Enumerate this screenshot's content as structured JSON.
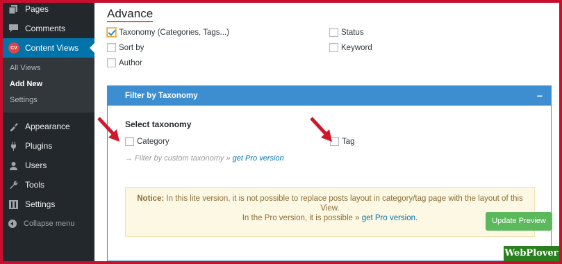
{
  "sidebar": {
    "items": [
      {
        "label": "Pages",
        "icon": "pages-icon"
      },
      {
        "label": "Comments",
        "icon": "comments-icon"
      },
      {
        "label": "Content Views",
        "icon": "content-views-icon",
        "badge": "CV"
      }
    ],
    "submenu": [
      "All Views",
      "Add New",
      "Settings"
    ],
    "items_after": [
      {
        "label": "Appearance",
        "icon": "appearance-icon"
      },
      {
        "label": "Plugins",
        "icon": "plugins-icon"
      },
      {
        "label": "Users",
        "icon": "users-icon"
      },
      {
        "label": "Tools",
        "icon": "tools-icon"
      },
      {
        "label": "Settings",
        "icon": "settings-icon"
      }
    ],
    "collapse_label": "Collapse menu"
  },
  "advance": {
    "title": "Advance",
    "options": {
      "taxonomy": "Taxonomy (Categories, Tags...)",
      "status": "Status",
      "sort_by": "Sort by",
      "keyword": "Keyword",
      "author": "Author"
    }
  },
  "panel": {
    "title": "Filter by Taxonomy",
    "toggle": "−",
    "select_title": "Select taxonomy",
    "category_label": "Category",
    "tag_label": "Tag",
    "hint_prefix": "→ Filter by custom taxonomy » ",
    "hint_link": "get Pro version",
    "notice_bold": "Notice:",
    "notice_text": " In this lite version, it is not possible to replace posts layout in category/tag page with the layout of this View.",
    "notice_text2": "In the Pro version, it is possible » ",
    "notice_link": "get Pro version",
    "notice_end": "."
  },
  "update_button": "Update Preview",
  "watermark": "WebPlover",
  "colors": {
    "sidebar_bg": "#23282d",
    "active_blue": "#0073aa",
    "panel_head": "#3c8ed0",
    "notice_bg": "#fcf8e3",
    "button_green": "#5cb85c",
    "arrow_red": "#d0182a",
    "border_red": "#c8102e"
  }
}
